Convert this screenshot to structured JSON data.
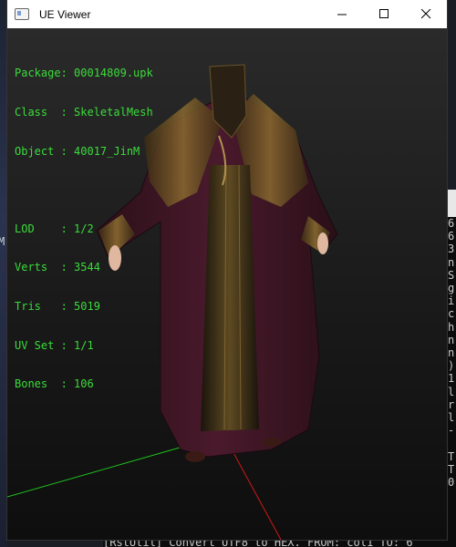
{
  "window": {
    "title": "UE Viewer",
    "icons": {
      "app": "window-icon",
      "minimize": "minimize-icon",
      "maximize": "maximize-icon",
      "close": "close-icon"
    }
  },
  "info": {
    "package": "Package: 00014809.upk",
    "class": "Class  : SkeletalMesh",
    "object": "Object : 40017_JinM",
    "lod": "LOD    : 1/2",
    "verts": "Verts  : 3544",
    "tris": "Tris   : 5019",
    "uvset": "UV Set : 1/1",
    "bones": "Bones  : 106"
  },
  "console_right": {
    "lines": [
      "6",
      "6",
      "3",
      "n",
      "S",
      "g",
      "i",
      "c",
      "h",
      "n",
      "n",
      ")",
      "1",
      "l",
      "r",
      "l",
      "-",
      "",
      "T",
      "T",
      "0"
    ]
  },
  "console_bottom": {
    "text": "[RstUtil] Convert UTF8 to HEX. FROM: col1  TO: 6"
  },
  "background": {
    "left_glyph": "M"
  },
  "colors": {
    "info_text": "#3bdc3b",
    "axis_x": "#d01818",
    "axis_z": "#1fc01f",
    "titlebar": "#ffffff"
  }
}
